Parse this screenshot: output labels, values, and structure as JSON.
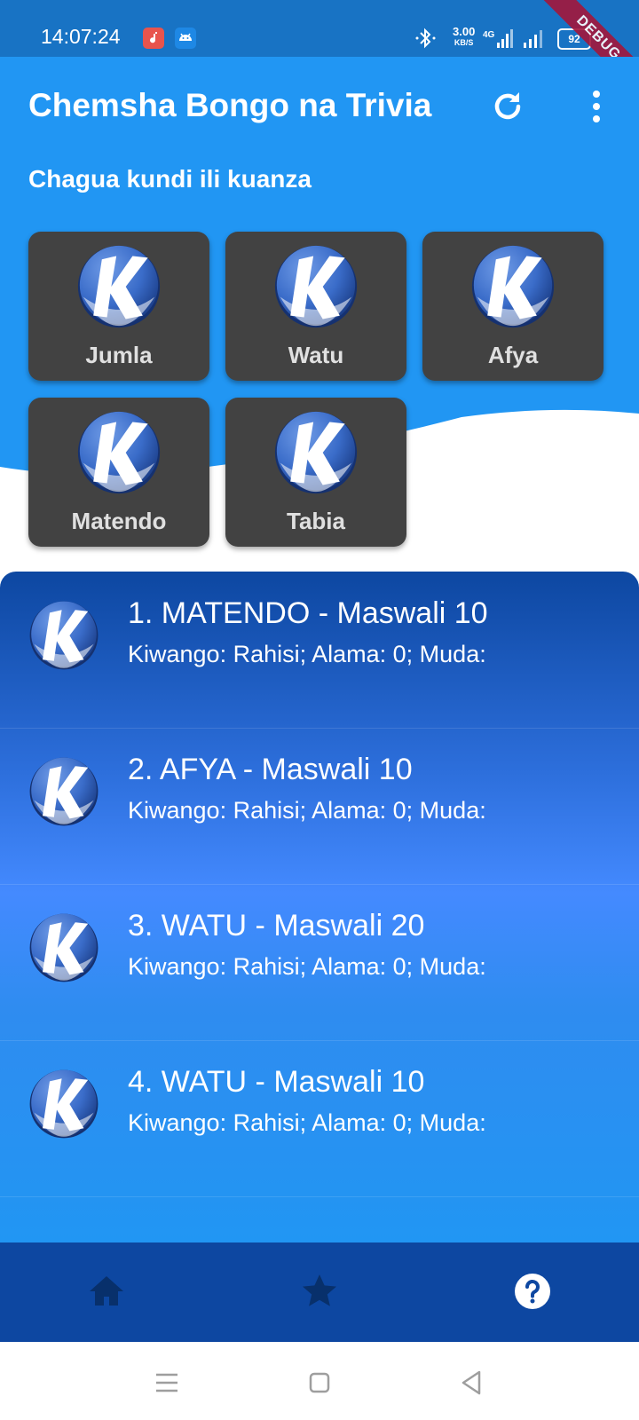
{
  "status_bar": {
    "time": "14:07:24",
    "net_speed_value": "3.00",
    "net_speed_unit": "KB/S",
    "network_type": "4G",
    "battery_level": "92",
    "debug_label": "DEBUG"
  },
  "header": {
    "title": "Chemsha Bongo na Trivia",
    "subtitle": "Chagua kundi ili kuanza"
  },
  "categories": [
    {
      "label": "Jumla"
    },
    {
      "label": "Watu"
    },
    {
      "label": "Afya"
    },
    {
      "label": "Matendo"
    },
    {
      "label": "Tabia"
    }
  ],
  "quizzes": [
    {
      "title": "1. MATENDO - Maswali 10",
      "info": "Kiwango: Rahisi; Alama: 0; Muda:"
    },
    {
      "title": "2. AFYA - Maswali 10",
      "info": "Kiwango: Rahisi; Alama: 0; Muda:"
    },
    {
      "title": "3. WATU - Maswali 20",
      "info": "Kiwango: Rahisi; Alama: 0; Muda:"
    },
    {
      "title": "4. WATU - Maswali 10",
      "info": "Kiwango: Rahisi; Alama: 0; Muda:"
    }
  ],
  "bottom_nav": {
    "items": [
      {
        "icon": "home-icon"
      },
      {
        "icon": "star-icon"
      },
      {
        "icon": "help-icon"
      }
    ]
  },
  "colors": {
    "primary": "#2196f3",
    "dark_primary": "#0d47a1",
    "card": "#424242"
  }
}
